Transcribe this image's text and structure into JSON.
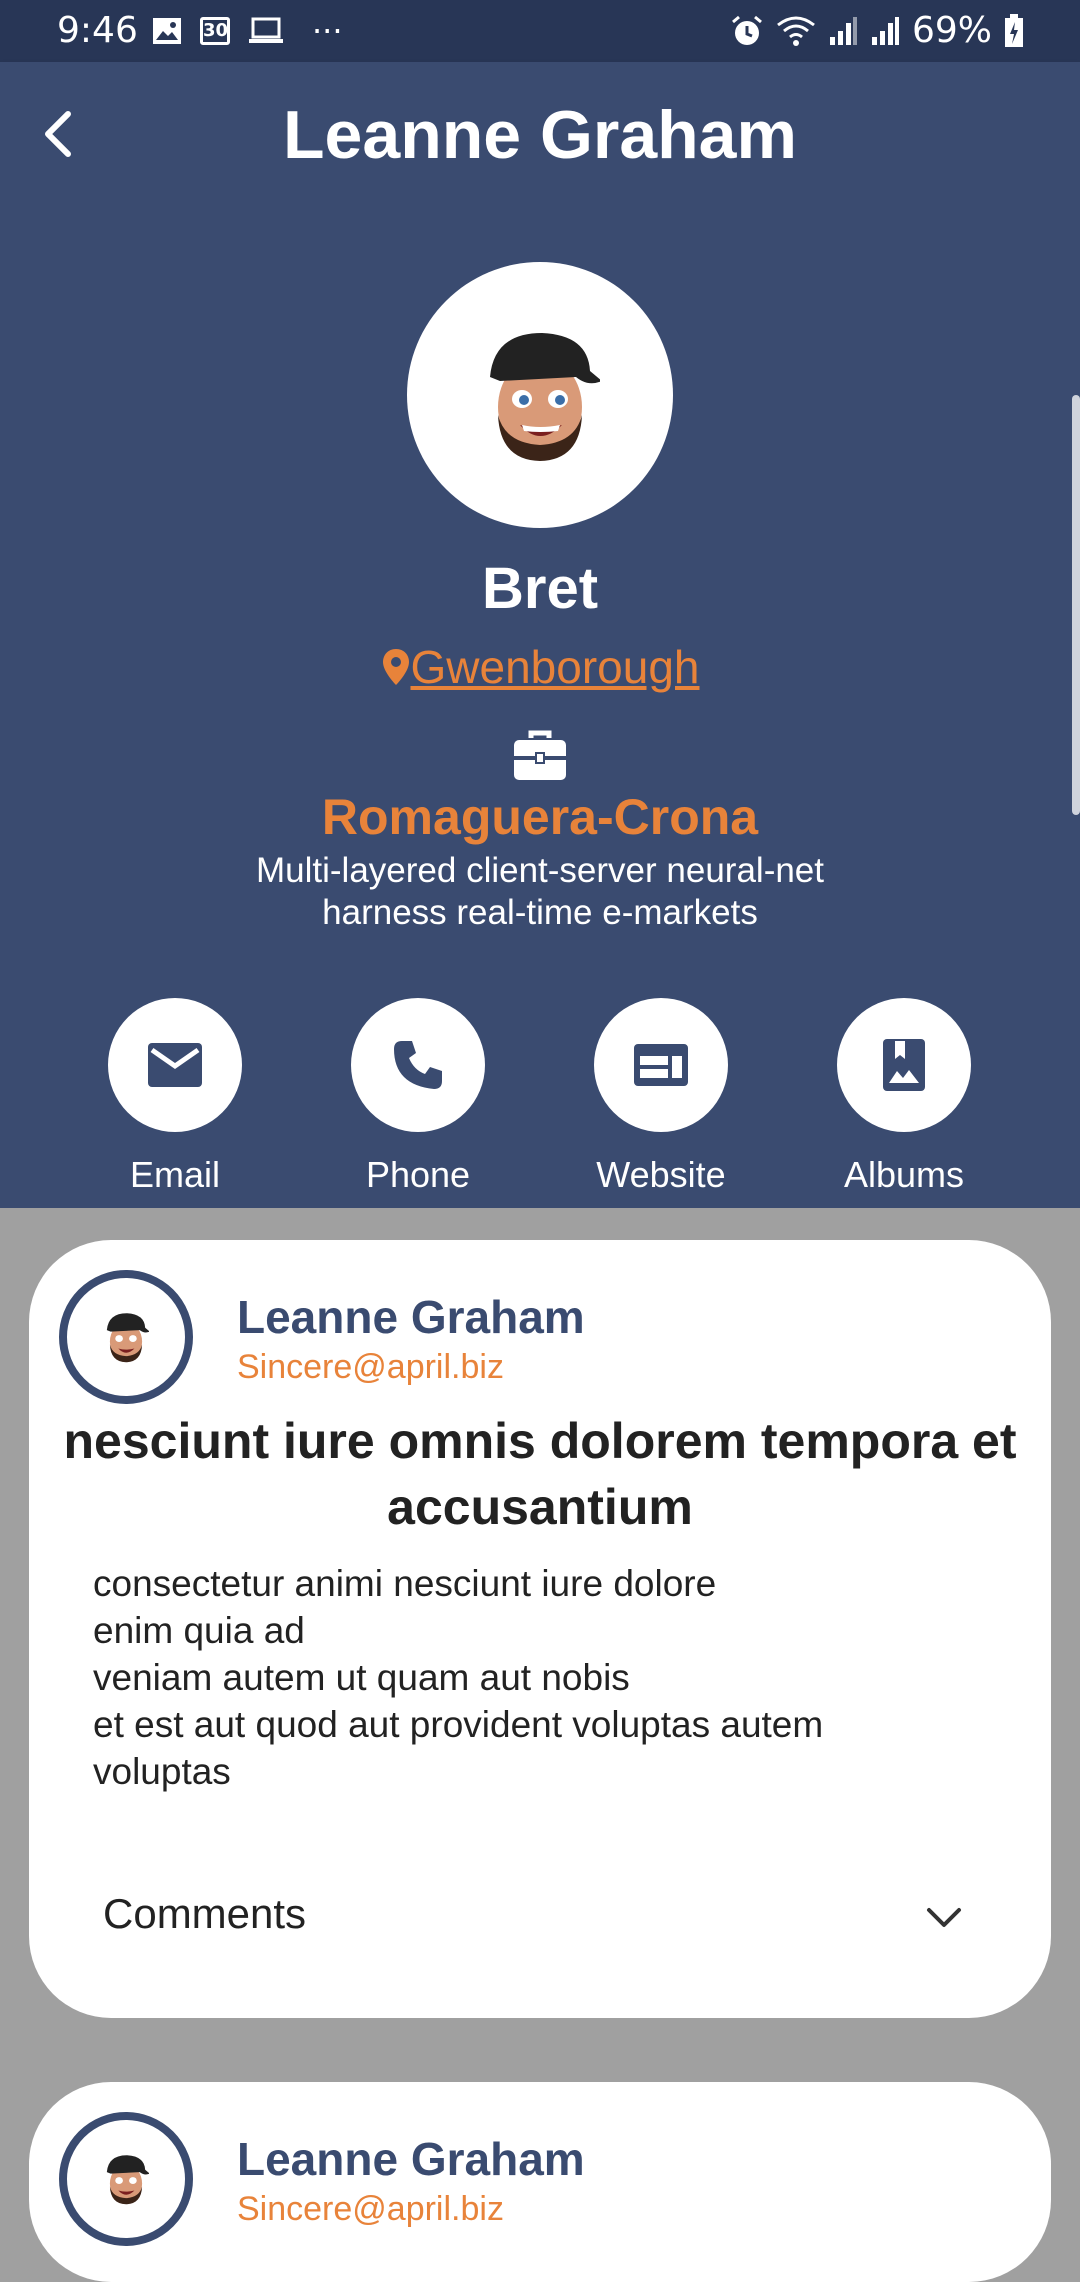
{
  "status_bar": {
    "time": "9:46",
    "calendar_badge": "30",
    "overflow": "···",
    "battery": "69%"
  },
  "app_bar": {
    "title": "Leanne Graham"
  },
  "profile": {
    "username": "Bret",
    "location": "Gwenborough",
    "company_name": "Romaguera-Crona",
    "catch_line_1": "Multi-layered client-server neural-net",
    "catch_line_2": "harness real-time e-markets"
  },
  "actions": [
    {
      "label": "Email",
      "icon": "mail-icon"
    },
    {
      "label": "Phone",
      "icon": "phone-icon"
    },
    {
      "label": "Website",
      "icon": "web-icon"
    },
    {
      "label": "Albums",
      "icon": "photo-album-icon"
    }
  ],
  "posts": [
    {
      "author": "Leanne Graham",
      "email": "Sincere@april.biz",
      "title": "nesciunt iure omnis dolorem tempora et accusantium",
      "body": "consectetur animi nesciunt iure dolore\nenim quia ad\nveniam autem ut quam aut nobis\net est aut quod aut provident voluptas autem\nvoluptas",
      "comments_label": "Comments"
    },
    {
      "author": "Leanne Graham",
      "email": "Sincere@april.biz"
    }
  ],
  "colors": {
    "primary": "#3a4b70",
    "status_bar": "#283656",
    "accent": "#e8833a",
    "background": "#a0a0a0"
  }
}
